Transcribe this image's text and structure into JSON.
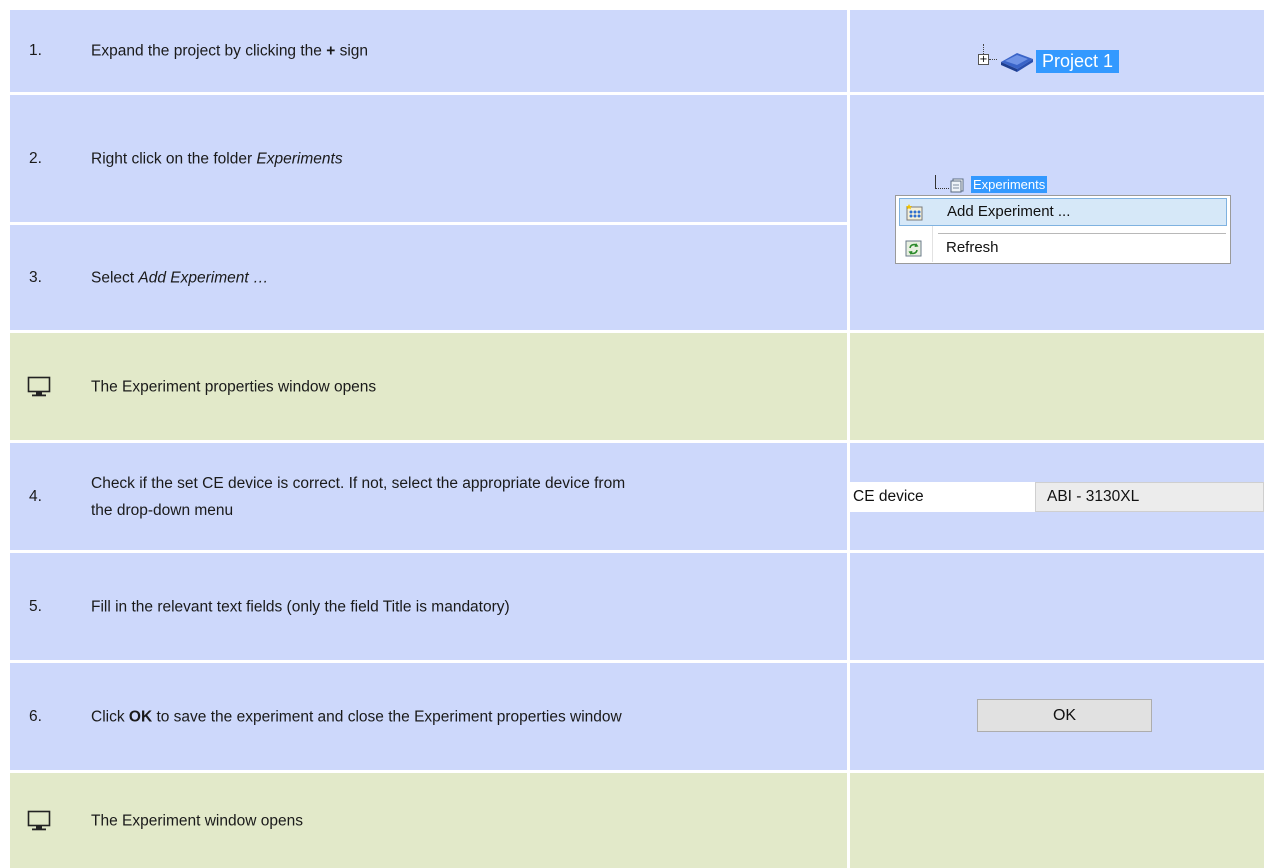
{
  "steps": {
    "s1": {
      "num": "1.",
      "pre": "Expand the project by clicking the ",
      "bold": "+",
      "post": " sign"
    },
    "s2": {
      "num": "2.",
      "pre": "Right click on the folder ",
      "ital": "Experiments"
    },
    "s3": {
      "num": "3.",
      "pre": "Select ",
      "ital": "Add Experiment …"
    },
    "r1": {
      "text": "The Experiment properties window opens"
    },
    "s4": {
      "num": "4.",
      "line1": "Check if the set CE device is correct. If not, select the appropriate device from",
      "line2": "the drop-down menu"
    },
    "s5": {
      "num": "5.",
      "text": "Fill in the relevant text fields (only the field Title is mandatory)"
    },
    "s6": {
      "num": "6.",
      "pre": "Click ",
      "bold": "OK",
      "post": " to save the experiment and close the Experiment properties window"
    },
    "r2": {
      "text": "The Experiment window opens"
    }
  },
  "widgets": {
    "project_label": "Project 1",
    "tree_expander": "+",
    "folder_label": "Experiments",
    "menu_add": "Add Experiment ...",
    "menu_refresh": "Refresh",
    "ce_label": "CE device",
    "ce_value": "ABI - 3130XL",
    "ok_label": "OK"
  },
  "colors": {
    "step_row": "#cdd8fb",
    "result_row": "#e2e9c9",
    "selection": "#3399ff"
  },
  "icons": [
    "monitor-icon",
    "project-book-icon",
    "folder-icon",
    "add-experiment-icon",
    "refresh-icon"
  ]
}
